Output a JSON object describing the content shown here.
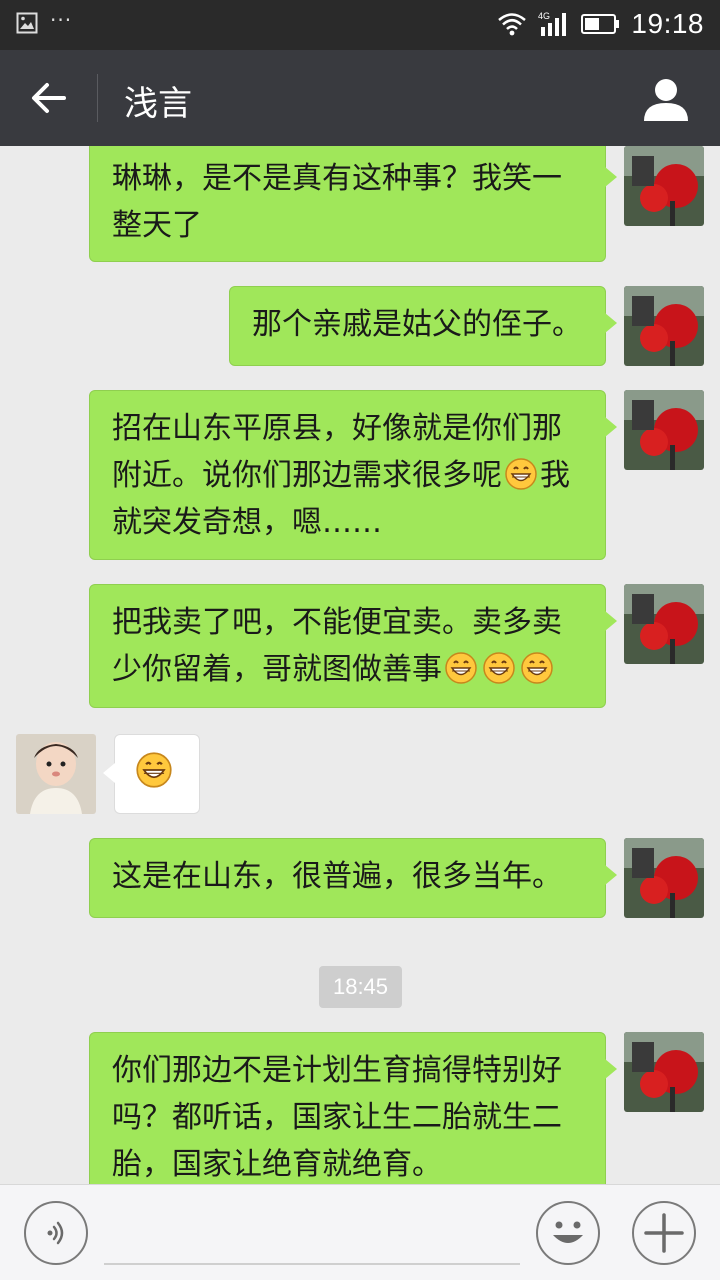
{
  "status_bar": {
    "time": "19:18",
    "network": "4G",
    "left_icons": [
      "image-icon",
      "more-dots-icon"
    ],
    "right_icons": [
      "wifi-icon",
      "signal-icon",
      "battery-icon"
    ]
  },
  "header": {
    "title": "浅言",
    "back_icon": "back-arrow-icon",
    "profile_icon": "person-icon"
  },
  "messages": [
    {
      "sender": "me",
      "lines": [
        "琳琳，是不是真有这种事？我笑一",
        "整天了"
      ],
      "emoji_after": 0
    },
    {
      "sender": "me",
      "lines": [
        "那个亲戚是姑父的侄子。"
      ],
      "emoji_after": 0
    },
    {
      "sender": "me",
      "lines": [
        "招在山东平原县，好像就是你们那",
        "附近。说你们那边需求很多呢",
        "我",
        "就突发奇想，嗯……"
      ],
      "emoji_after": 1
    },
    {
      "sender": "me",
      "lines": [
        "把我卖了吧，不能便宜卖。卖多卖",
        "少你留着，哥就图做善事"
      ],
      "emoji_after": 3
    },
    {
      "sender": "other",
      "lines": [],
      "emoji_after": 1
    },
    {
      "sender": "me",
      "lines": [
        "这是在山东，很普遍，很多当年。"
      ],
      "emoji_after": 0
    },
    {
      "sender": "me",
      "lines": [
        "你们那边不是计划生育搞得特别好",
        "吗？都听话，国家让生二胎就生二",
        "胎，国家让绝育就绝育。"
      ],
      "emoji_after": 0
    }
  ],
  "timestamp": "18:45",
  "input": {
    "value": "",
    "placeholder": ""
  },
  "colors": {
    "my_bubble": "#a0e75a",
    "their_bubble": "#ffffff",
    "title_bar": "#393a3f",
    "status_bar": "#2a2a2a",
    "background": "#ebebeb"
  }
}
